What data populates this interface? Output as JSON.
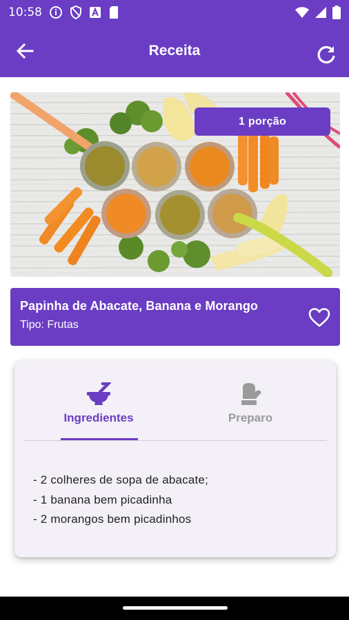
{
  "status_bar": {
    "time": "10:58",
    "left_icons": [
      "info-icon",
      "shield-icon",
      "font-icon",
      "sd-card-icon"
    ],
    "right_icons": [
      "wifi-icon",
      "signal-icon",
      "battery-icon"
    ]
  },
  "app_bar": {
    "title": "Receita",
    "back_icon": "arrow-back-icon",
    "refresh_icon": "refresh-icon"
  },
  "hero": {
    "portion_label": "1 porção"
  },
  "recipe": {
    "title": "Papinha de Abacate, Banana e Morango",
    "type": "Tipo: Frutas",
    "favorite_icon": "heart-outline-icon"
  },
  "tabs": [
    {
      "label": "Ingredientes",
      "icon": "mortar-pestle-icon",
      "active": true
    },
    {
      "label": "Preparo",
      "icon": "chef-mitt-icon",
      "active": false
    }
  ],
  "ingredients": [
    "- 2 colheres de sopa de abacate;",
    "- 1 banana bem picadinha",
    "- 2 morangos bem picadinhos"
  ],
  "colors": {
    "primary": "#6a3dc4",
    "tab_inactive": "#9a9a9a",
    "card_background": "#f4f0f8"
  }
}
